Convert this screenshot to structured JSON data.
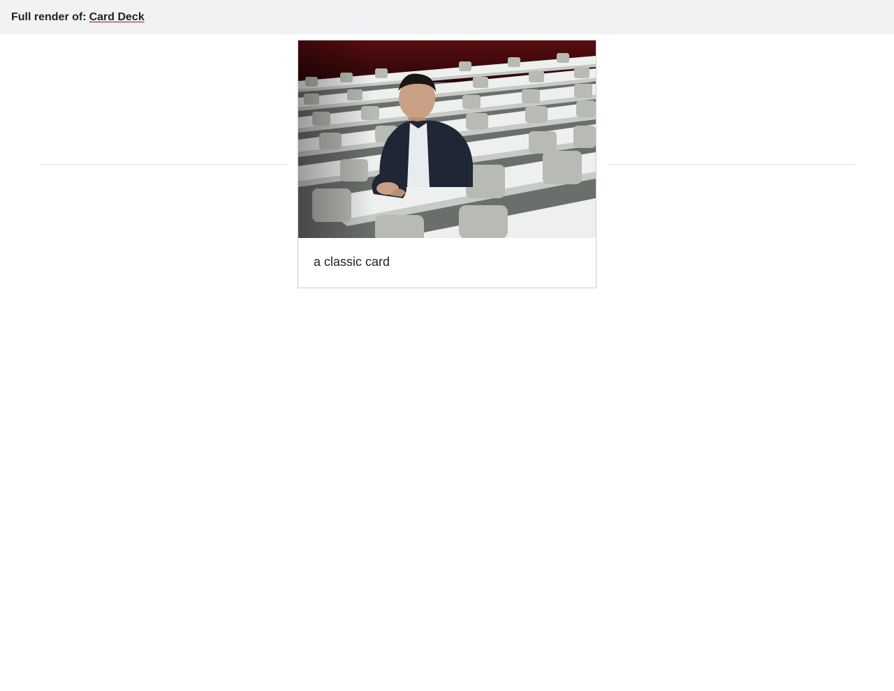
{
  "header": {
    "prefix": "Full render of:",
    "link_label": "Card Deck"
  },
  "card": {
    "image_alt": "Man in a dark suit seated in an empty lecture hall with rows of white desks and grey chairs",
    "caption": "a classic card"
  },
  "colors": {
    "topbar_bg": "#f1f2f4",
    "accent_underline": "#8b1a1a",
    "card_border": "#cfcfcf",
    "rule": "#e2e2e2"
  }
}
